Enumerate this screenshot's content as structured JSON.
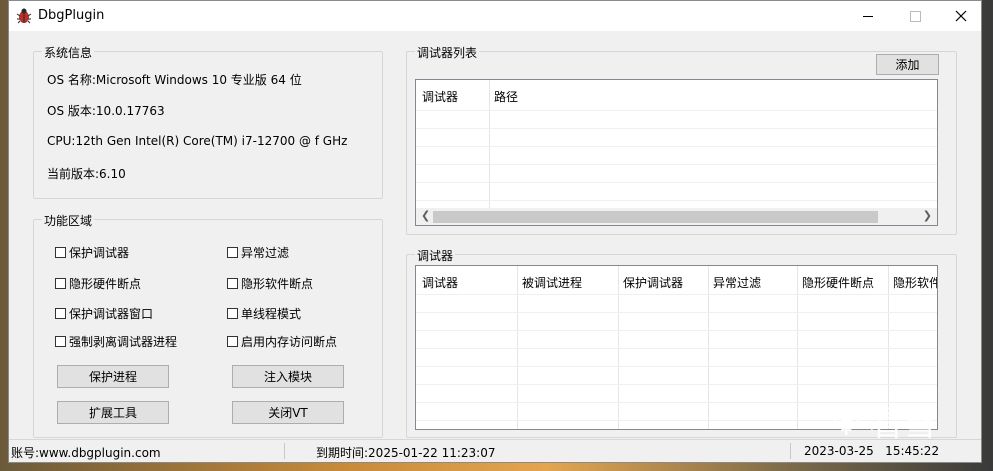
{
  "window": {
    "title": "DbgPlugin"
  },
  "system_info": {
    "legend": "系统信息",
    "lines": [
      "OS 名称:Microsoft Windows 10 专业版 64 位",
      "OS 版本:10.0.17763",
      "CPU:12th Gen Intel(R) Core(TM) i7-12700 @ f GHz",
      "当前版本:6.10"
    ]
  },
  "functions": {
    "legend": "功能区域",
    "checkboxes_left": [
      "保护调试器",
      "隐形硬件断点",
      "保护调试器窗口",
      "强制剥离调试器进程"
    ],
    "checkboxes_right": [
      "异常过滤",
      "隐形软件断点",
      "单线程模式",
      "启用内存访问断点"
    ],
    "buttons": {
      "protect_process": "保护进程",
      "inject_module": "注入模块",
      "extend_tools": "扩展工具",
      "close_vt": "关闭VT"
    }
  },
  "debugger_list": {
    "legend": "调试器列表",
    "add_button": "添加",
    "columns": [
      "调试器",
      "路径"
    ]
  },
  "debugger": {
    "legend": "调试器",
    "columns": [
      "调试器",
      "被调试进程",
      "保护调试器",
      "异常过滤",
      "隐形硬件断点",
      "隐形软件"
    ]
  },
  "status": {
    "account": "账号:www.dbgplugin.com",
    "expiry": "到期时间:2025-01-22 11:23:07",
    "datetime": "2023-03-25   15:45:22"
  },
  "watermark": {
    "text": "看雪"
  },
  "icons": {
    "app": "bug-icon",
    "minimize": "minimize-icon",
    "maximize": "maximize-icon",
    "close": "close-icon"
  }
}
